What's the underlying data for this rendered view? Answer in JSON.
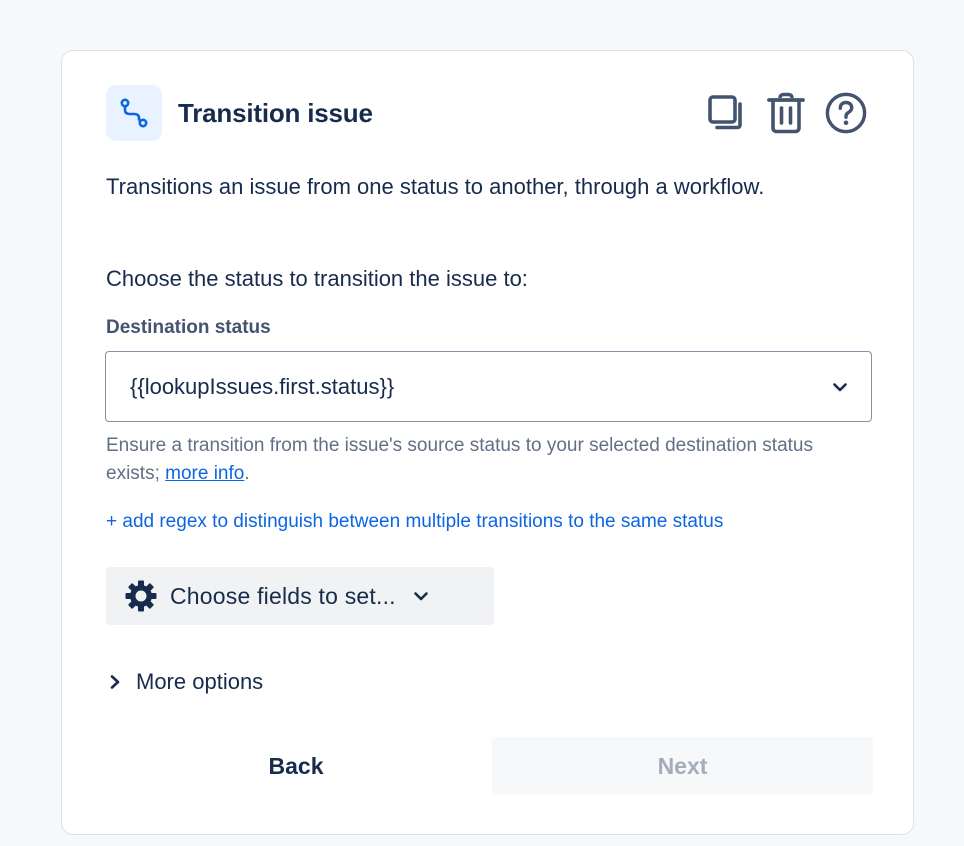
{
  "panel": {
    "title": "Transition issue",
    "icon": "transition-route-icon",
    "actions": [
      {
        "name": "copy-icon"
      },
      {
        "name": "trash-icon"
      },
      {
        "name": "help-icon"
      }
    ]
  },
  "description": "Transitions an issue from one status to another, through a workflow.",
  "prompt": "Choose the status to transition the issue to:",
  "destination": {
    "label": "Destination status",
    "value": "{{lookupIssues.first.status}}",
    "helper_text": "Ensure a transition from the issue's source status to your selected destination status exists;",
    "helper_link": "more info",
    "helper_end": "."
  },
  "regex_link": "+ add regex to distinguish between multiple transitions to the same status",
  "fields_button": {
    "label": "Choose fields to set...",
    "icon": "gear-icon"
  },
  "more_options": "More options",
  "footer": {
    "back": "Back",
    "next": "Next"
  },
  "colors": {
    "accent": "#0c66e4",
    "text": "#172b4d",
    "subtle": "#626f86",
    "icon_bg": "#e9f2ff",
    "disabled_text": "#a5adba"
  }
}
